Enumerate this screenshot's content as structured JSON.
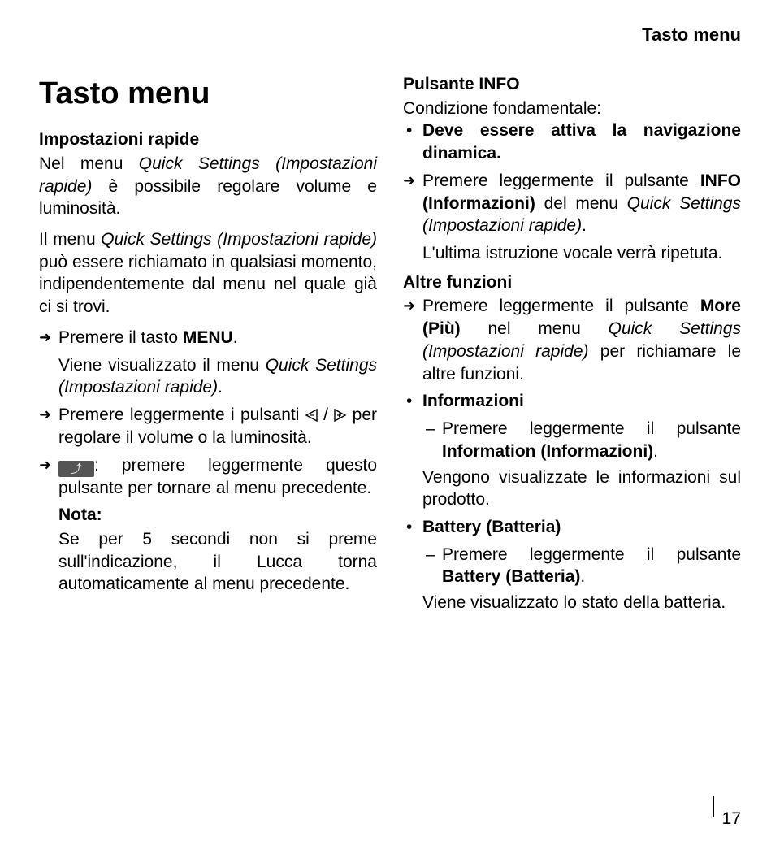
{
  "running_header": "Tasto menu",
  "page_number": "17",
  "left": {
    "title": "Tasto menu",
    "subhead": "Impostazioni rapide",
    "intro1a": "Nel menu ",
    "intro1b": "Quick Settings (Impostazioni rapide)",
    "intro1c": " è possibile regolare volume e luminosità.",
    "intro2a": "Il menu ",
    "intro2b": "Quick Settings (Impostazioni rapide)",
    "intro2c": " può essere richiamato in qualsiasi momento, indipendentemente dal menu nel quale già ci si trovi.",
    "act1a": "Premere il tasto ",
    "act1b": "MENU",
    "act1c": ".",
    "res1a": "Viene visualizzato il menu ",
    "res1b": "Quick Settings (Impostazioni rapide)",
    "res1c": ".",
    "act2a": "Premere leggermente i pulsanti ",
    "act2mid": " / ",
    "act2b": " per regolare il volume o la luminosità.",
    "act3a": ": premere leggermente questo pulsante per tornare al menu precedente.",
    "note_label": "Nota:",
    "note_body": "Se per 5 secondi non si preme sull'indicazione, il Lucca torna automaticamente al menu precedente."
  },
  "right": {
    "infohead": "Pulsante INFO",
    "cond": "Condizione fondamentale:",
    "cond_b": "Deve essere attiva la navigazione dinamica.",
    "act1a": "Premere leggermente il pulsante ",
    "act1b": "INFO (Informazioni)",
    "act1c": " del menu ",
    "act1d": "Quick Settings (Impostazioni rapide)",
    "act1e": ".",
    "res1": "L'ultima istruzione vocale verrà ripetuta.",
    "altfun": "Altre funzioni",
    "act2a": "Premere leggermente il pulsante ",
    "act2b": "More (Più)",
    "act2c": " nel menu ",
    "act2d": "Quick Settings (Impostazioni rapide)",
    "act2e": " per richiamare le altre funzioni.",
    "info_b": "Informazioni",
    "info_d1a": "Premere leggermente il pulsante ",
    "info_d1b": "Information (Informazioni)",
    "info_d1c": ".",
    "info_res": "Vengono visualizzate le informazioni sul prodotto.",
    "batt_b": "Battery (Batteria)",
    "batt_d1a": "Premere leggermente il pulsante ",
    "batt_d1b": "Battery (Batteria)",
    "batt_d1c": ".",
    "batt_res": "Viene visualizzato lo stato della batteria."
  }
}
